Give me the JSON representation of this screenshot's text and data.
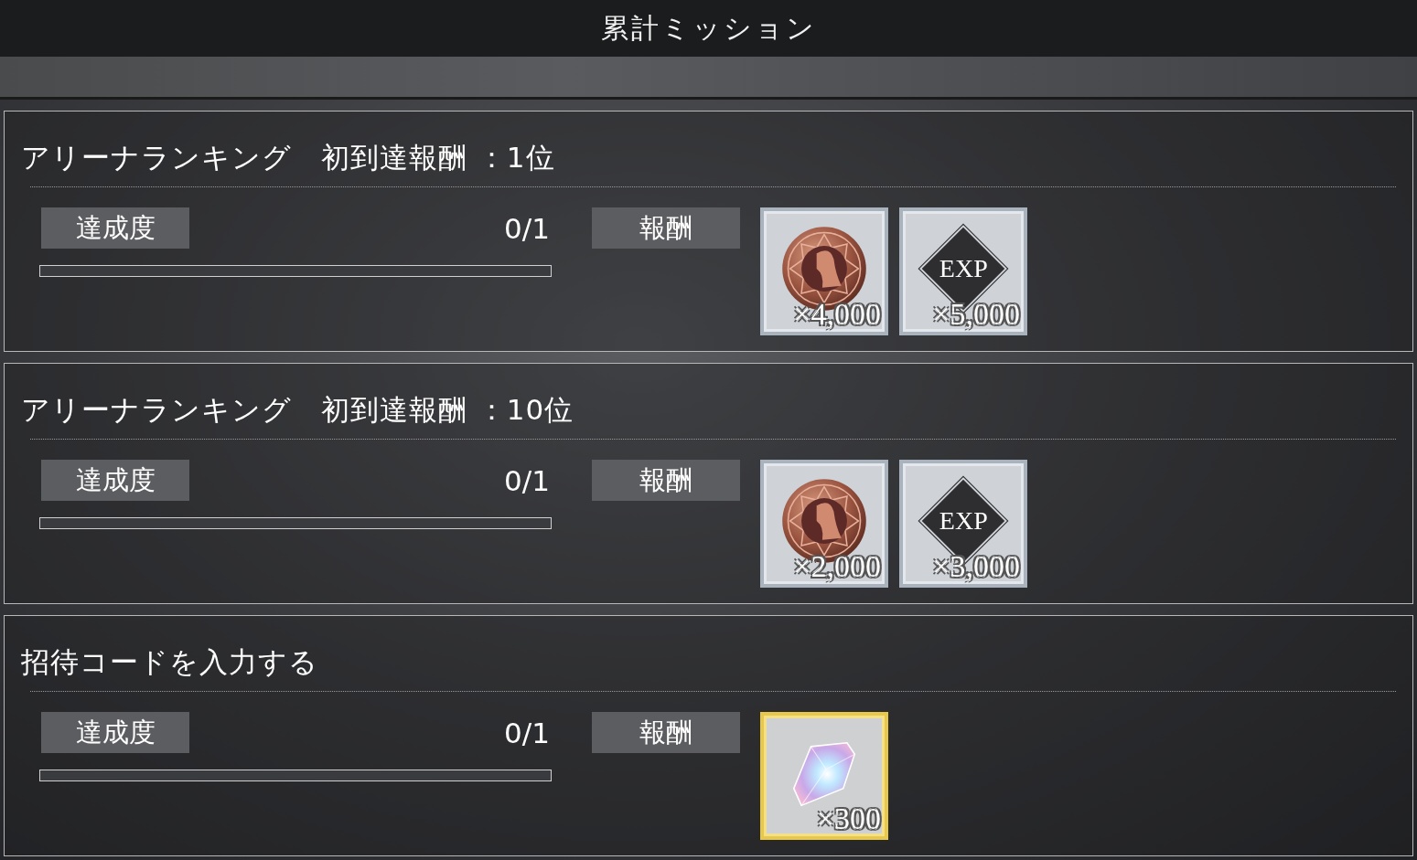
{
  "header": {
    "title": "累計ミッション"
  },
  "missions": [
    {
      "title": "アリーナランキング　初到達報酬 ：1位",
      "progress_label": "達成度",
      "progress": "0/1",
      "level": 0,
      "reward_label": "報酬",
      "rewards": [
        {
          "kind": "coin",
          "quantity": "×4,000"
        },
        {
          "kind": "exp",
          "label": "EXP",
          "quantity": "×5,000"
        }
      ]
    },
    {
      "title": "アリーナランキング　初到達報酬 ：10位",
      "progress_label": "達成度",
      "progress": "0/1",
      "level": 0,
      "reward_label": "報酬",
      "rewards": [
        {
          "kind": "coin",
          "quantity": "×2,000"
        },
        {
          "kind": "exp",
          "label": "EXP",
          "quantity": "×3,000"
        }
      ]
    },
    {
      "title": "招待コードを入力する",
      "progress_label": "達成度",
      "progress": "0/1",
      "level": 0,
      "reward_label": "報酬",
      "rewards": [
        {
          "kind": "crystal",
          "quantity": "×300"
        }
      ]
    }
  ]
}
